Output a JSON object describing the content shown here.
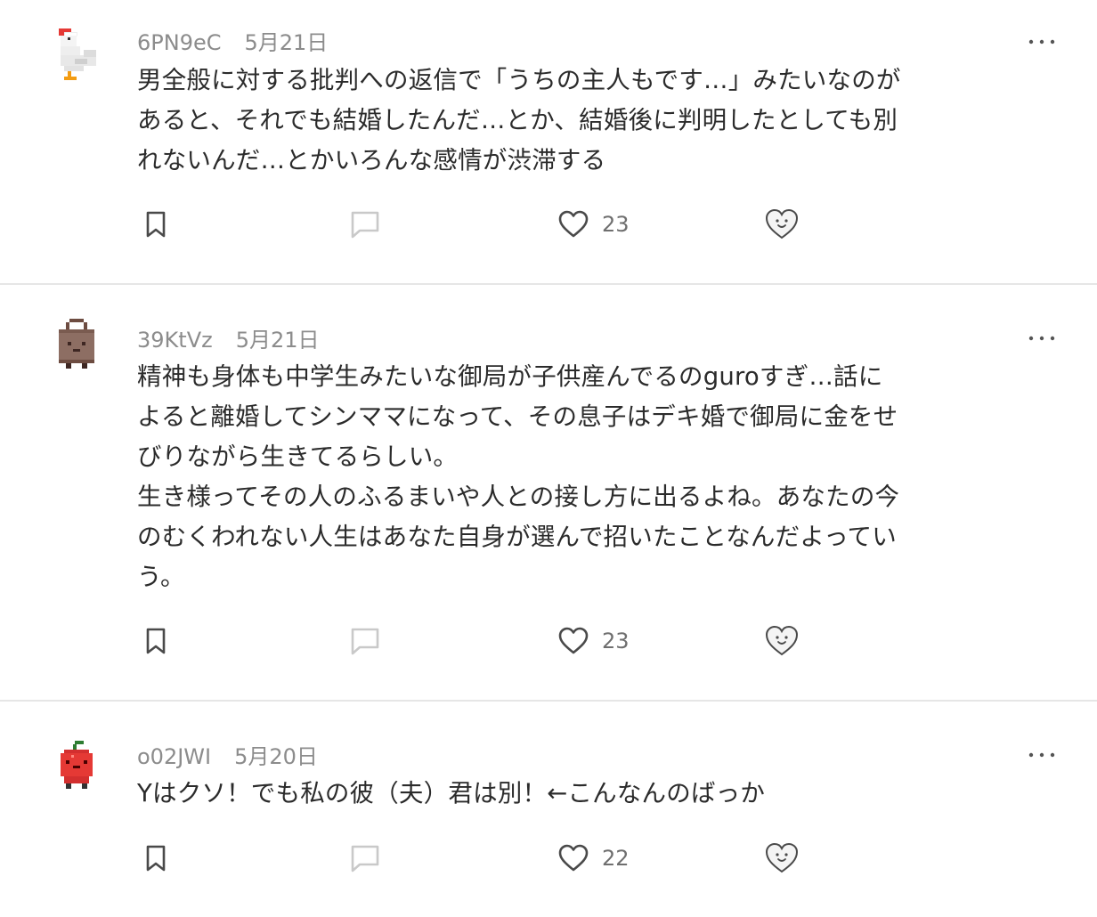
{
  "posts": [
    {
      "user": "6PN9eC",
      "date": "5月21日",
      "avatar": "chicken-avatar-icon",
      "lines": [
        "男全般に対する批判への返信で「うちの主人もです…」みたいなのが",
        "あると、それでも結婚したんだ…とか、結婚後に判明したとしても別",
        "れないんだ…とかいろんな感情が渋滞する"
      ],
      "likes": "23"
    },
    {
      "user": "39KtVz",
      "date": "5月21日",
      "avatar": "bag-avatar-icon",
      "lines": [
        "精神も身体も中学生みたいな御局が子供産んでるのguroすぎ…話に",
        "よると離婚してシンママになって、その息子はデキ婚で御局に金をせ",
        "びりながら生きてるらしい。",
        "生き様ってその人のふるまいや人との接し方に出るよね。あなたの今",
        "のむくわれない人生はあなた自身が選んで招いたことなんだよってい",
        "う。"
      ],
      "likes": "23"
    },
    {
      "user": "o02JWI",
      "date": "5月20日",
      "avatar": "apple-avatar-icon",
      "lines": [
        "Yはクソ！でも私の彼（夫）君は別！←こんなんのばっか"
      ],
      "likes": "22"
    }
  ],
  "more_label": "…",
  "colors": {
    "text": "#2b2b2b",
    "meta": "#8c8c8c",
    "icon": "#4a4a4a",
    "divider": "#e6e6e6"
  }
}
